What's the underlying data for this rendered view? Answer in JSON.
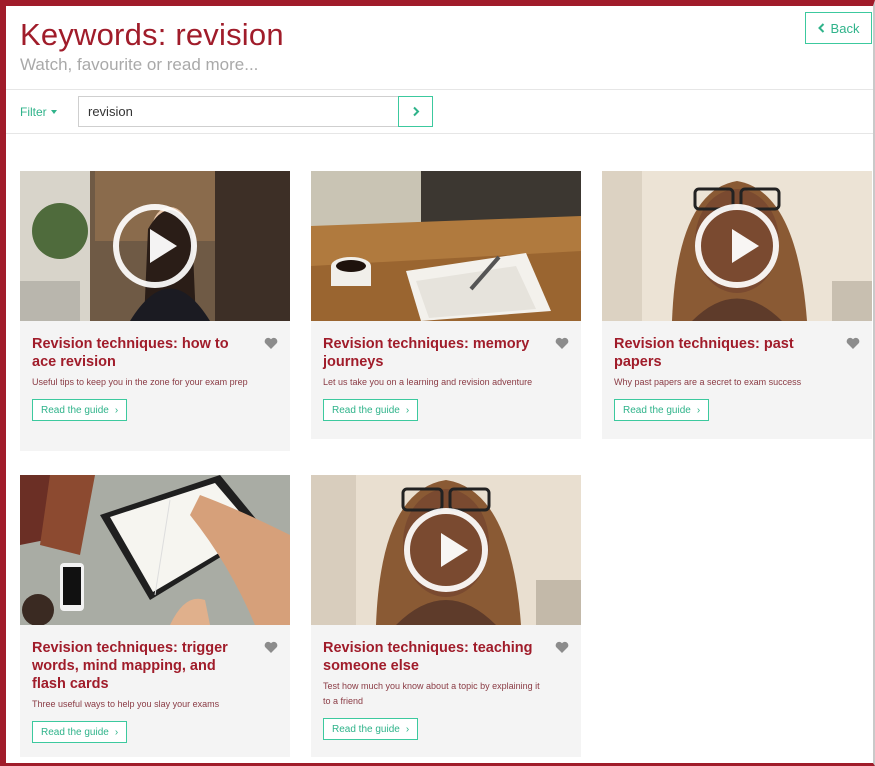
{
  "header": {
    "title": "Keywords: revision",
    "subtitle": "Watch, favourite or read more..."
  },
  "back_button": {
    "label": "Back",
    "icon": "chevron-left-icon"
  },
  "filter": {
    "label": "Filter",
    "search_value": "revision",
    "submit_icon": "chevron-right-icon"
  },
  "colors": {
    "brand": "#a01c2a",
    "accent": "#3cc99e",
    "card_bg": "#f4f4f4"
  },
  "cards": [
    {
      "title": "Revision techniques: how to ace revision",
      "description": "Useful tips to keep you in the zone for your exam prep",
      "button": "Read the guide",
      "video": true
    },
    {
      "title": "Revision techniques: memory journeys",
      "description": "Let us take you on a learning and revision adventure",
      "button": "Read the guide",
      "video": false
    },
    {
      "title": "Revision techniques: past papers",
      "description": "Why past papers are a secret to exam success",
      "button": "Read the guide",
      "video": true
    },
    {
      "title": "Revision techniques: trigger words, mind mapping, and flash cards",
      "description": "Three useful ways to help you slay your exams",
      "button": "Read the guide",
      "video": false
    },
    {
      "title": "Revision techniques: teaching someone else",
      "description": "Test how much you know about a topic by explaining it to a friend",
      "button": "Read the guide",
      "video": true
    }
  ]
}
